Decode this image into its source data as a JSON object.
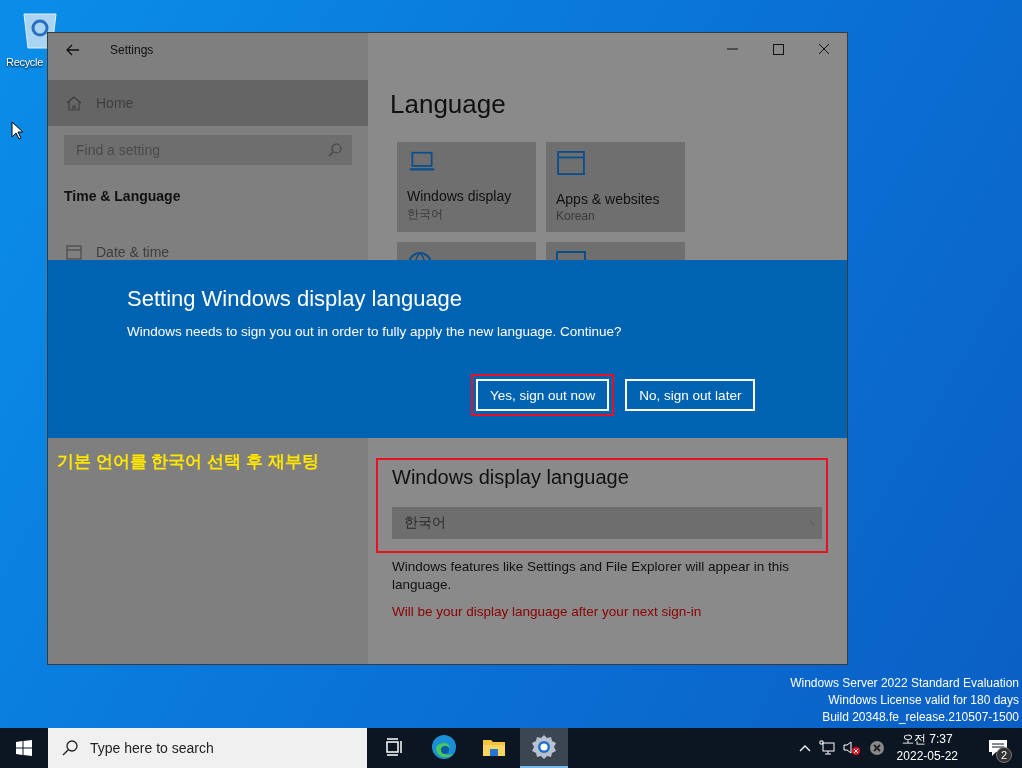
{
  "desktop": {
    "icons": [
      {
        "label": "Recycle"
      }
    ],
    "watermark": [
      "Windows Server 2022 Standard Evaluation",
      "Windows License valid for 180 days",
      "Build 20348.fe_release.210507-1500"
    ]
  },
  "window": {
    "title": "Settings",
    "sidebar": {
      "home": "Home",
      "search": {
        "placeholder": "Find a setting"
      },
      "section": "Time & Language",
      "items": [
        {
          "label": "Date & time",
          "kind": "calendar"
        }
      ]
    },
    "main": {
      "heading": "Language",
      "tiles": [
        {
          "kind": "laptop",
          "title": "Windows display",
          "subtitle": "한국어"
        },
        {
          "kind": "window",
          "title": "Apps & websites",
          "subtitle": "Korean"
        },
        {
          "kind": "globe"
        },
        {
          "kind": "keyboard"
        }
      ]
    },
    "dialog": {
      "title": "Setting Windows display language",
      "message": "Windows needs to sign you out in order to fully apply the new language. Continue?",
      "buttons": [
        {
          "label": "Yes, sign out now",
          "highlighted": true
        },
        {
          "label": "No, sign out later",
          "highlighted": false
        }
      ]
    },
    "annotation": "기본 언어를 한국어 선택 후 재부팅",
    "display_language": {
      "heading": "Windows display language",
      "value": "한국어",
      "description": "Windows features like Settings and File Explorer will appear in this language.",
      "status": "Will be your display language after your next sign-in",
      "highlighted": true
    }
  },
  "taskbar": {
    "search": {
      "placeholder": "Type here to search"
    },
    "apps": [
      {
        "kind": "task-view",
        "active": false
      },
      {
        "kind": "edge",
        "active": false
      },
      {
        "kind": "explorer",
        "active": false
      },
      {
        "kind": "settings",
        "active": true
      }
    ],
    "tray": {
      "time": "오전 7:37",
      "date": "2022-05-22",
      "notifications": "2"
    }
  }
}
